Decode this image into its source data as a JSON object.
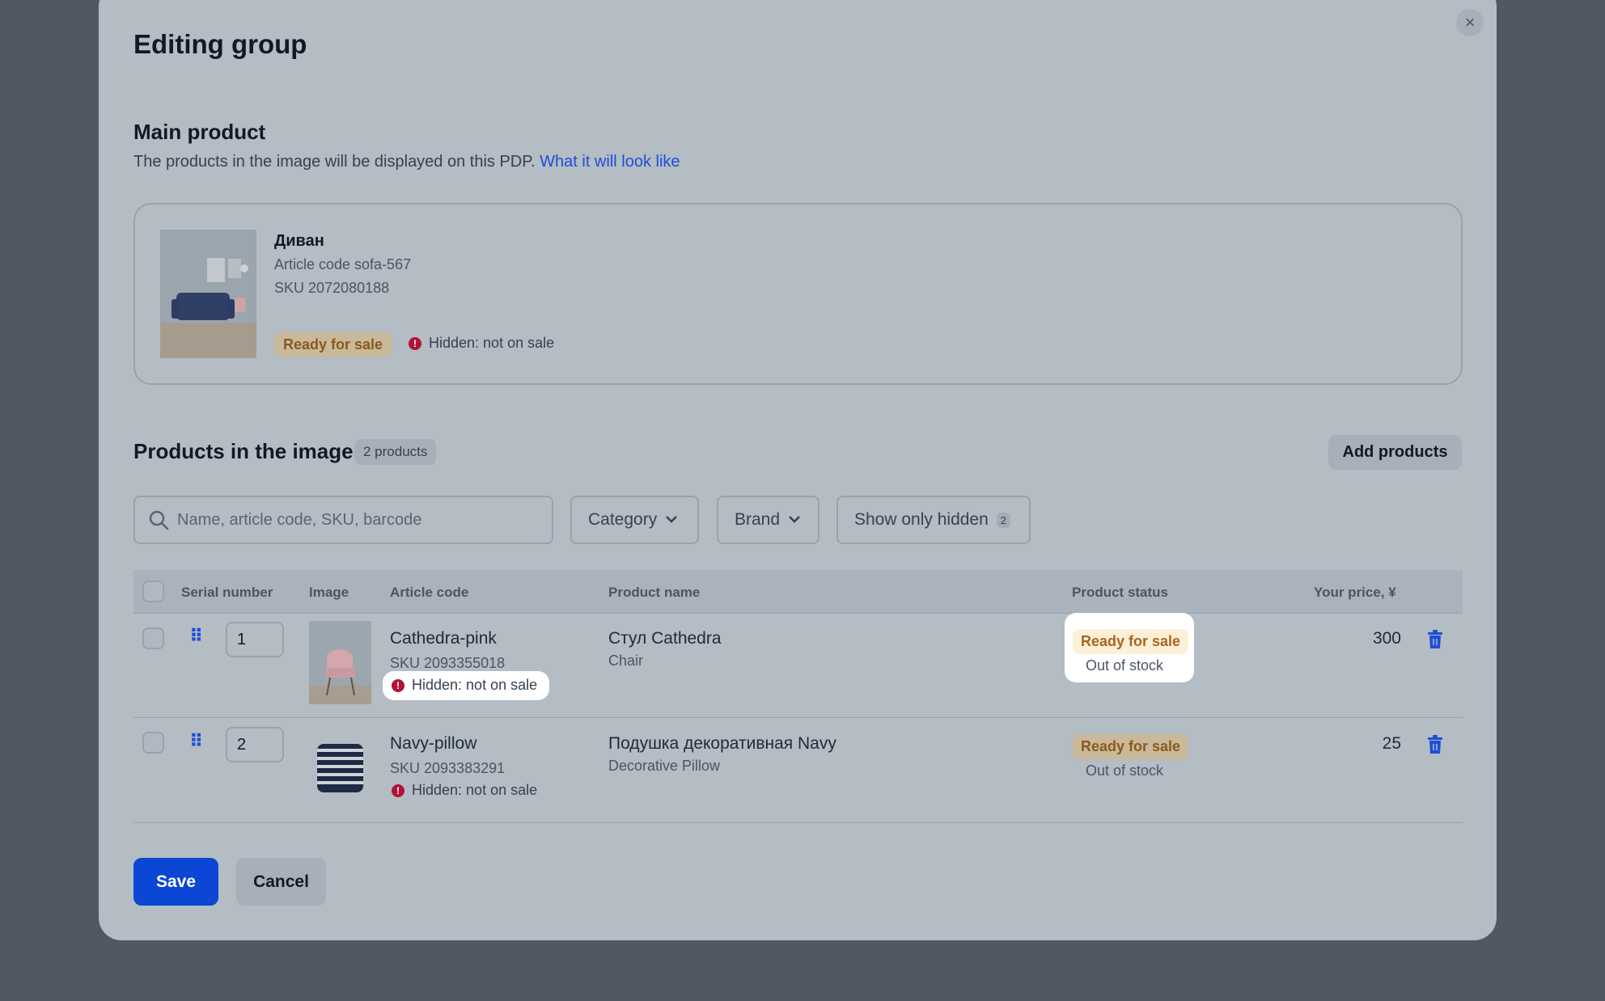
{
  "modal": {
    "title": "Editing group",
    "close_icon": "close-icon"
  },
  "main_product": {
    "heading": "Main product",
    "description": "The products in the image will be displayed on this PDP.",
    "link": "What it will look like",
    "name": "Диван",
    "article": "Article code sofa-567",
    "sku": "SKU 2072080188",
    "status": "Ready for sale",
    "hidden": "Hidden: not on sale"
  },
  "products": {
    "heading": "Products in the image",
    "count": "2 products",
    "add_label": "Add products",
    "search_placeholder": "Name, article code, SKU, barcode",
    "filters": {
      "category": "Category",
      "brand": "Brand",
      "hidden": "Show only hidden",
      "hidden_count": "2"
    },
    "columns": {
      "serial": "Serial number",
      "image": "Image",
      "article": "Article code",
      "name": "Product name",
      "status": "Product status",
      "price": "Your price, ¥"
    },
    "rows": [
      {
        "serial": "1",
        "article": "Cathedra-pink",
        "sku": "SKU 2093355018",
        "hidden": "Hidden: not on sale",
        "name": "Стул Cathedra",
        "category": "Chair",
        "status": "Ready for sale",
        "stock": "Out of stock",
        "price": "300"
      },
      {
        "serial": "2",
        "article": "Navy-pillow",
        "sku": "SKU 2093383291",
        "hidden": "Hidden: not on sale",
        "name": "Подушка декоративная Navy",
        "category": "Decorative Pillow",
        "status": "Ready for sale",
        "stock": "Out of stock",
        "price": "25"
      }
    ]
  },
  "footer": {
    "save": "Save",
    "cancel": "Cancel"
  },
  "colors": {
    "accent": "#0b47d4",
    "badge_text": "#8a5a1c",
    "warning": "#b4123a"
  }
}
